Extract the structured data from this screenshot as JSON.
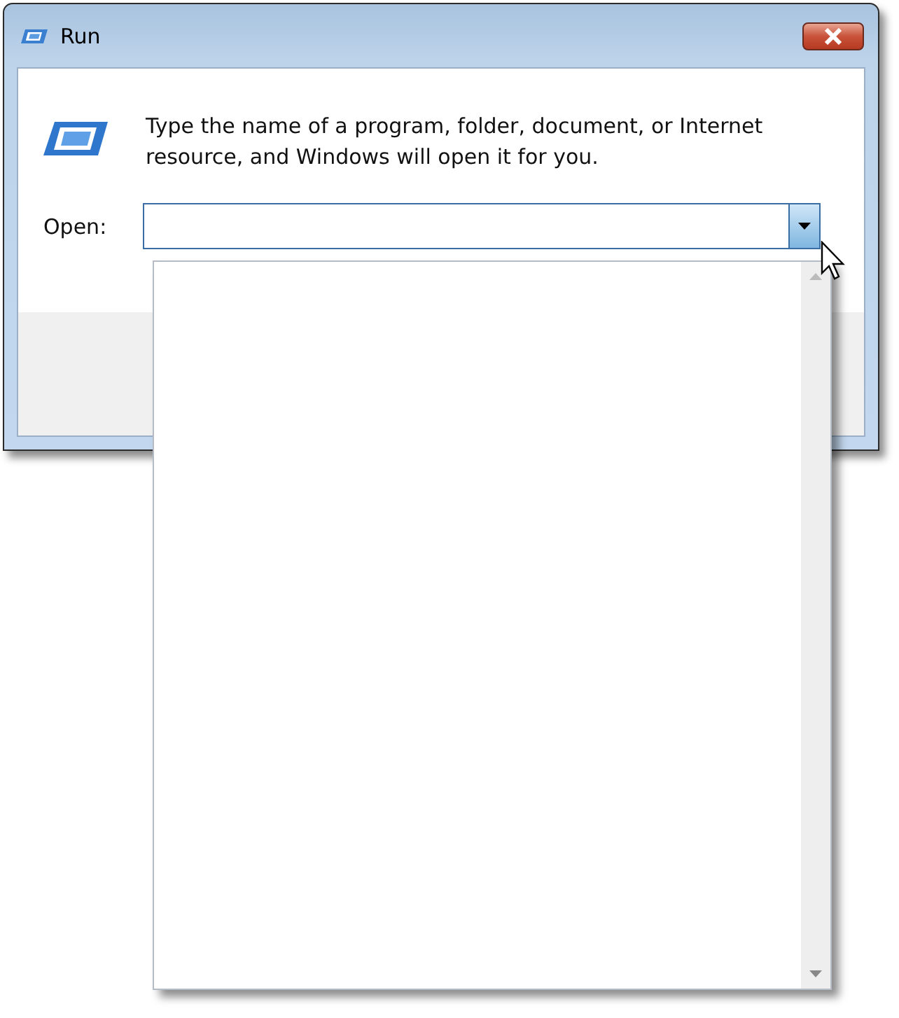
{
  "window": {
    "title": "Run"
  },
  "description": "Type the name of a program, folder, document, or Internet resource, and Windows will open it for you.",
  "open_field": {
    "label": "Open:",
    "expanded": true
  }
}
